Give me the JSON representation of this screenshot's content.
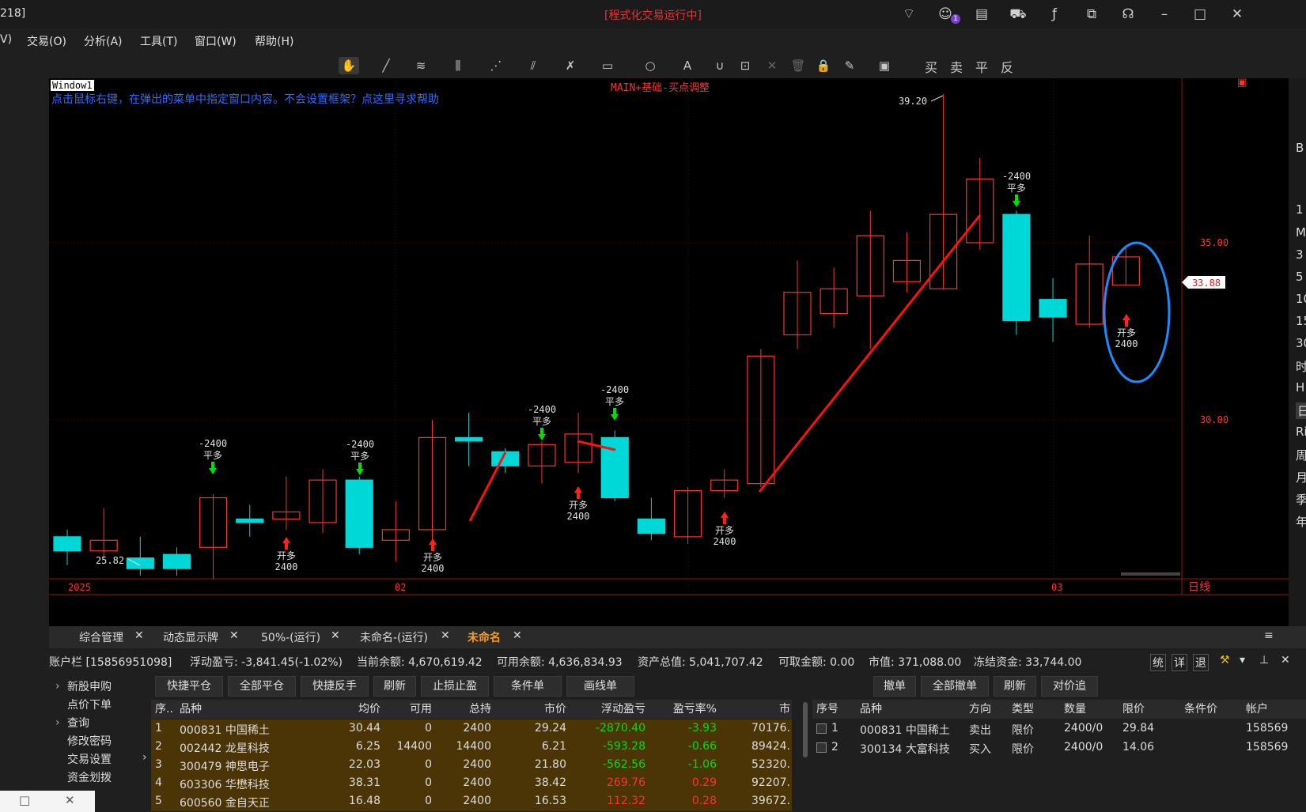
{
  "titlebar": {
    "left_text": "218]",
    "title": "[程式化交易运行中]"
  },
  "menu": [
    "V)",
    "交易(O)",
    "分析(A)",
    "工具(T)",
    "窗口(W)",
    "帮助(H)"
  ],
  "trade_buttons": [
    "买",
    "卖",
    "平",
    "反"
  ],
  "chart": {
    "window_label": "Window1",
    "hint": "点击鼠标右键，在弹出的菜单中指定窗口内容。不会设置框架？点这里寻求帮助",
    "indicator": "MAIN+基础-买点调整",
    "price_labels": [
      "35.00",
      "30.00"
    ],
    "current_price": "33.88",
    "high_label": "39.20",
    "low_label": "25.82",
    "x_labels": [
      "2025",
      "02",
      "03"
    ],
    "period": "日线",
    "open_signal": "开多",
    "close_signal": "平多",
    "qty": "2400",
    "neg_qty": "-2400"
  },
  "chart_data": {
    "type": "candlestick",
    "y_ticks": [
      30,
      35
    ],
    "candles": [
      {
        "o": 26.7,
        "c": 26.3,
        "h": 26.9,
        "l": 25.9
      },
      {
        "o": 26.3,
        "c": 26.6,
        "h": 27.5,
        "l": 26.1
      },
      {
        "o": 26.1,
        "c": 25.8,
        "h": 26.7,
        "l": 25.6
      },
      {
        "o": 26.2,
        "c": 25.8,
        "h": 26.4,
        "l": 25.6
      },
      {
        "o": 26.4,
        "c": 27.8,
        "h": 27.9,
        "l": 25.5
      },
      {
        "o": 27.2,
        "c": 27.1,
        "h": 27.6,
        "l": 26.7
      },
      {
        "o": 27.2,
        "c": 27.4,
        "h": 28.4,
        "l": 26.9
      },
      {
        "o": 27.1,
        "c": 28.3,
        "h": 28.6,
        "l": 26.8
      },
      {
        "o": 28.3,
        "c": 26.4,
        "h": 28.4,
        "l": 26.2
      },
      {
        "o": 26.6,
        "c": 26.9,
        "h": 27.7,
        "l": 26.0
      },
      {
        "o": 26.9,
        "c": 29.5,
        "h": 30.0,
        "l": 26.6
      },
      {
        "o": 29.5,
        "c": 29.4,
        "h": 30.2,
        "l": 28.7
      },
      {
        "o": 29.1,
        "c": 28.7,
        "h": 29.2,
        "l": 28.5
      },
      {
        "o": 28.7,
        "c": 29.3,
        "h": 29.4,
        "l": 28.2
      },
      {
        "o": 28.8,
        "c": 29.6,
        "h": 30.2,
        "l": 28.5
      },
      {
        "o": 29.5,
        "c": 27.8,
        "h": 29.7,
        "l": 27.7
      },
      {
        "o": 27.2,
        "c": 26.8,
        "h": 27.8,
        "l": 26.6
      },
      {
        "o": 26.7,
        "c": 28.0,
        "h": 28.1,
        "l": 26.5
      },
      {
        "o": 28.0,
        "c": 28.3,
        "h": 28.6,
        "l": 27.8
      },
      {
        "o": 28.2,
        "c": 31.8,
        "h": 32.0,
        "l": 28.1
      },
      {
        "o": 32.4,
        "c": 33.6,
        "h": 34.5,
        "l": 32.0
      },
      {
        "o": 33.0,
        "c": 33.7,
        "h": 34.3,
        "l": 32.6
      },
      {
        "o": 33.5,
        "c": 35.2,
        "h": 35.9,
        "l": 32.0
      },
      {
        "o": 33.9,
        "c": 34.5,
        "h": 35.3,
        "l": 33.6
      },
      {
        "o": 33.7,
        "c": 35.8,
        "h": 39.2,
        "l": 33.7
      },
      {
        "o": 35.0,
        "c": 36.8,
        "h": 37.4,
        "l": 34.8
      },
      {
        "o": 35.8,
        "c": 32.8,
        "h": 35.9,
        "l": 32.4
      },
      {
        "o": 33.4,
        "c": 32.9,
        "h": 34.0,
        "l": 32.2
      },
      {
        "o": 32.7,
        "c": 34.4,
        "h": 35.2,
        "l": 32.6
      },
      {
        "o": 33.8,
        "c": 34.6,
        "h": 34.9,
        "l": 33.8
      }
    ]
  },
  "right_strip": [
    "B",
    "1",
    "M",
    "3",
    "5",
    "10",
    "15",
    "30",
    "时",
    "H",
    "日",
    "Ri",
    "周",
    "月",
    "季",
    "年"
  ],
  "tabs": [
    "综合管理",
    "动态显示牌",
    "50%-(运行)",
    "未命名-(运行)",
    "未命名"
  ],
  "account": {
    "id": "账户栏 [15856951098]",
    "float_pl": "浮动盈亏: -3,841.45(-1.02%)",
    "balance": "当前余额: 4,670,619.42",
    "available": "可用余额: 4,636,834.93",
    "total": "资产总值: 5,041,707.42",
    "withdrawable": "可取金额: 0.00",
    "market_value": "市值: 371,088.00",
    "frozen": "冻结资金: 33,744.00",
    "ctrl": [
      "统",
      "详",
      "退"
    ]
  },
  "nav": [
    "新股申购",
    "点价下单",
    "查询",
    "修改密码",
    "交易设置",
    "资金划拨"
  ],
  "pos_buttons": [
    "快捷平仓",
    "全部平仓",
    "快捷反手",
    "刷新",
    "止损止盈",
    "条件单",
    "画线单"
  ],
  "order_buttons": [
    "撤单",
    "全部撤单",
    "刷新",
    "对价追"
  ],
  "pos_headers": [
    "序..",
    "品种",
    "均价",
    "可用",
    "总持",
    "市价",
    "浮动盈亏",
    "盈亏率%",
    "市"
  ],
  "positions": [
    [
      "1",
      "000831 中国稀土",
      "30.44",
      "0",
      "2400",
      "29.24",
      "-2870.40",
      "-3.93",
      "70176."
    ],
    [
      "2",
      "002442 龙星科技",
      "6.25",
      "14400",
      "14400",
      "6.21",
      "-593.28",
      "-0.66",
      "89424."
    ],
    [
      "3",
      "300479 神思电子",
      "22.03",
      "0",
      "2400",
      "21.80",
      "-562.56",
      "-1.06",
      "52320."
    ],
    [
      "4",
      "603306 华懋科技",
      "38.31",
      "0",
      "2400",
      "38.42",
      "269.76",
      "0.29",
      "92207."
    ],
    [
      "5",
      "600560 金自天正",
      "16.48",
      "0",
      "2400",
      "16.53",
      "112.32",
      "0.28",
      "39672."
    ]
  ],
  "order_headers": [
    "序号",
    "品种",
    "方向",
    "类型",
    "数量",
    "限价",
    "条件价",
    "帐户"
  ],
  "orders": [
    [
      "1",
      "000831 中国稀土",
      "卖出",
      "限价",
      "2400/0",
      "29.84",
      "",
      "158569"
    ],
    [
      "2",
      "300134 大富科技",
      "买入",
      "限价",
      "2400/0",
      "14.06",
      "",
      "158569"
    ]
  ]
}
